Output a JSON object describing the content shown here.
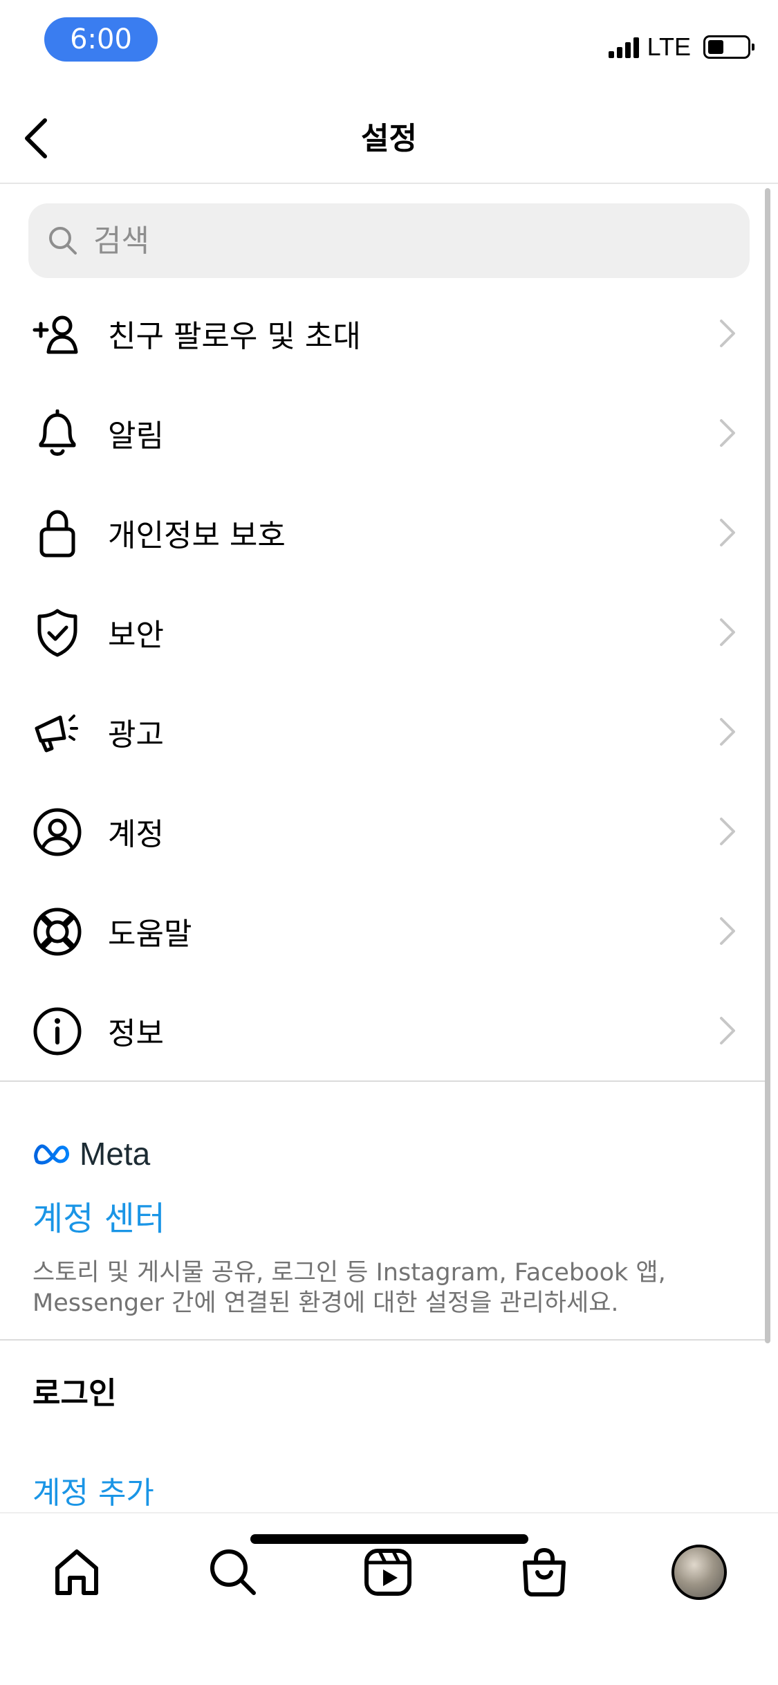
{
  "status_bar": {
    "time": "6:00",
    "network": "LTE"
  },
  "header": {
    "title": "설정"
  },
  "search": {
    "placeholder": "검색"
  },
  "menu": {
    "items": [
      {
        "label": "친구 팔로우 및 초대",
        "icon": "add-person-icon"
      },
      {
        "label": "알림",
        "icon": "bell-icon"
      },
      {
        "label": "개인정보 보호",
        "icon": "lock-icon"
      },
      {
        "label": "보안",
        "icon": "shield-check-icon"
      },
      {
        "label": "광고",
        "icon": "megaphone-icon"
      },
      {
        "label": "계정",
        "icon": "account-circle-icon"
      },
      {
        "label": "도움말",
        "icon": "lifebuoy-icon"
      },
      {
        "label": "정보",
        "icon": "info-icon"
      }
    ]
  },
  "meta_section": {
    "logo_text": "Meta",
    "accounts_center": "계정 센터",
    "description": "스토리 및 게시물 공유, 로그인 등 Instagram, Facebook 앱, Messenger 간에 연결된 환경에 대한 설정을 관리하세요."
  },
  "login_section": {
    "heading": "로그인",
    "add_account": "계정 추가"
  },
  "tab_bar": {
    "tabs": [
      "home-icon",
      "search-icon",
      "reels-icon",
      "shop-icon",
      "profile-avatar"
    ]
  },
  "colors": {
    "link": "#1a95e6",
    "time_pill": "#3a7df0",
    "search_bg": "#efefef"
  }
}
